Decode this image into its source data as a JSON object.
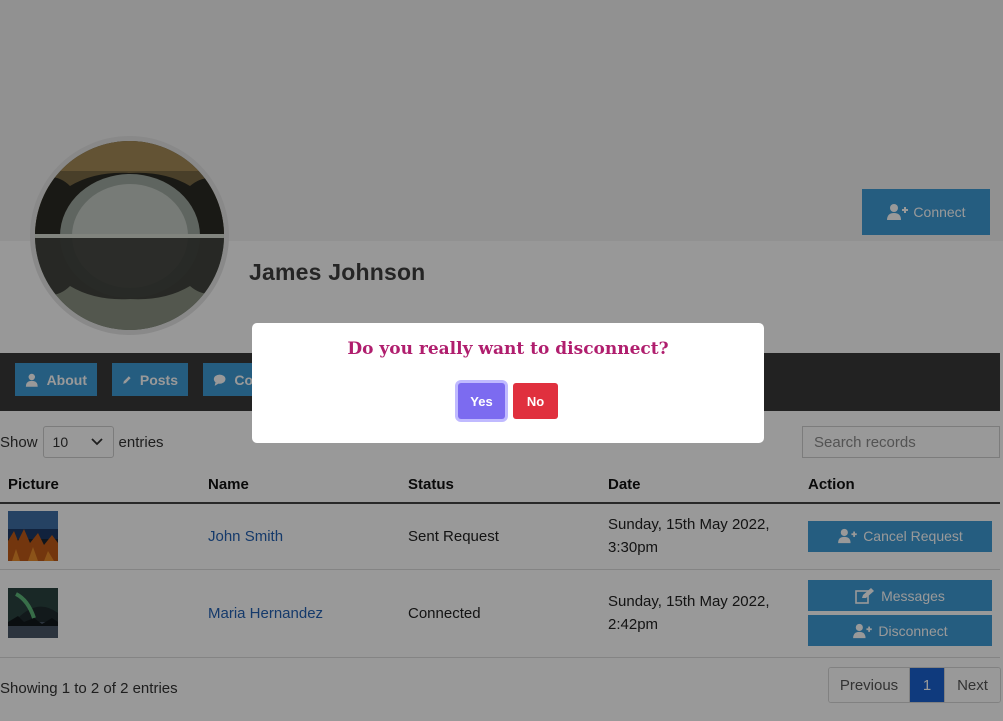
{
  "profile": {
    "name": "James Johnson",
    "connect_label": "Connect"
  },
  "nav": {
    "about": "About",
    "posts": "Posts",
    "comments": "Co"
  },
  "table_controls": {
    "show_label": "Show",
    "entries_value": "10",
    "entries_label": "entries",
    "search_placeholder": "Search records"
  },
  "table": {
    "headers": [
      "Picture",
      "Name",
      "Status",
      "Date",
      "Action"
    ],
    "rows": [
      {
        "name": "John Smith",
        "status": "Sent Request",
        "date_line1": "Sunday, 15th May 2022,",
        "date_line2": "3:30pm",
        "actions": [
          "Cancel Request"
        ]
      },
      {
        "name": "Maria Hernandez",
        "status": "Connected",
        "date_line1": "Sunday, 15th May 2022,",
        "date_line2": "2:42pm",
        "actions": [
          "Messages",
          "Disconnect"
        ]
      }
    ]
  },
  "footer": {
    "info": "Showing 1 to 2 of 2 entries",
    "prev": "Previous",
    "page": "1",
    "next": "Next"
  },
  "modal": {
    "question": "Do you really want to disconnect?",
    "yes_label": "Yes",
    "no_label": "No"
  },
  "colors": {
    "accent": "#3e9bd6",
    "nav_bg": "#3a3a3a",
    "yes": "#7c6bf0",
    "no": "#e0303e",
    "question": "#b01e6e",
    "link": "#2361b3"
  }
}
